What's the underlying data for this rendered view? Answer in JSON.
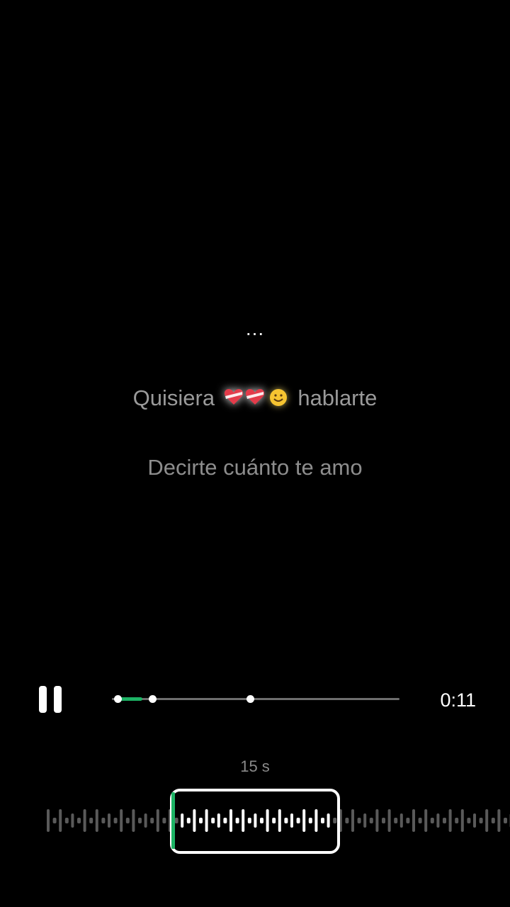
{
  "lyrics": {
    "ellipsis": "...",
    "line1_before": "Quisiera",
    "line1_after": "hablarte",
    "line1_emojis": [
      "heart-icon",
      "heart-icon",
      "smiling-face-icon"
    ],
    "line2": "Decirte cuánto te amo"
  },
  "player": {
    "state": "playing",
    "pause_icon": "pause-icon",
    "current_time": "0:11",
    "progress_fraction": 0.09,
    "marker_fractions": [
      0.02,
      0.14,
      0.48
    ]
  },
  "clip": {
    "duration_label": "15 s",
    "selection_start_fraction": 0.335,
    "selection_end_fraction": 0.66
  },
  "colors": {
    "background": "#000000",
    "accent": "#1db365",
    "text_dim": "#9a9a9a",
    "text_bright": "#ffffff"
  }
}
